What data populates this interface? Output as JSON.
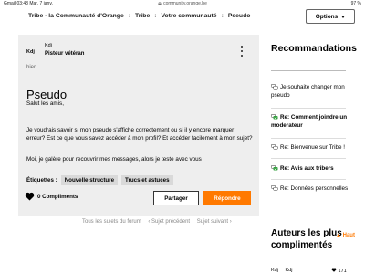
{
  "status_bar": {
    "carrier": "Gmail",
    "time": "03:48",
    "date": "Mar. 7 janv.",
    "url": "community.orange.be",
    "battery": "97 %"
  },
  "breadcrumb": {
    "items": [
      "Tribe - la Communauté d'Orange",
      "Tribe",
      "Votre communauté",
      "Pseudo"
    ],
    "separator": ":"
  },
  "options_label": "Options",
  "post": {
    "author_short": "Kdj",
    "author_name": "Kdj",
    "author_rank": "Pisteur vétéran",
    "date": "hier",
    "title": "Pseudo",
    "greeting": "Salut les amis,",
    "body_1": "Je voudrais savoir si mon pseudo s'affiche correctement ou si il y encore marquer erreur? Est ce que vous savez accéder à mon profil? Et accéder facilement à mon sujet?",
    "body_2": "Moi, je galère pour recouvrir mes messages, alors je teste avec vous",
    "tags_label": "Étiquettes :",
    "tags": [
      "Nouvelle structure",
      "Trucs et astuces"
    ],
    "kudos": "0 Compliments",
    "share_label": "Partager",
    "reply_label": "Répondre"
  },
  "pager": {
    "all": "Tous les sujets du forum",
    "prev": "‹ Sujet précédent",
    "next": "Sujet suivant ›"
  },
  "sidebar": {
    "title": "Recommandations",
    "items": [
      {
        "text": "Je souhaite changer mon pseudo",
        "bold": false,
        "solved": false
      },
      {
        "text": "Re: Comment joindre un moderateur",
        "bold": true,
        "solved": true
      },
      {
        "text": "Re: Bienvenue sur Tribe !",
        "bold": false,
        "solved": false
      },
      {
        "text": "Re: Avis aux tribers",
        "bold": true,
        "solved": true
      },
      {
        "text": "Re: Données personnelles",
        "bold": false,
        "solved": false
      }
    ],
    "authors_title": "Auteurs les plus complimentés",
    "back_to_top": "Haut",
    "bottom_author_short": "Kdj",
    "bottom_author_name": "Kdj",
    "bottom_count": "171"
  },
  "colors": {
    "accent": "#ff7900",
    "card_bg": "#eeeeee",
    "solved_green": "#2e9e3a"
  },
  "icons": {
    "kebab": "more-vertical-icon",
    "heart": "heart-icon",
    "lock": "lock-icon",
    "conversation": "conversation-icon",
    "solved": "check-conversation-icon",
    "back_to_top": "arrow-up-icon"
  }
}
